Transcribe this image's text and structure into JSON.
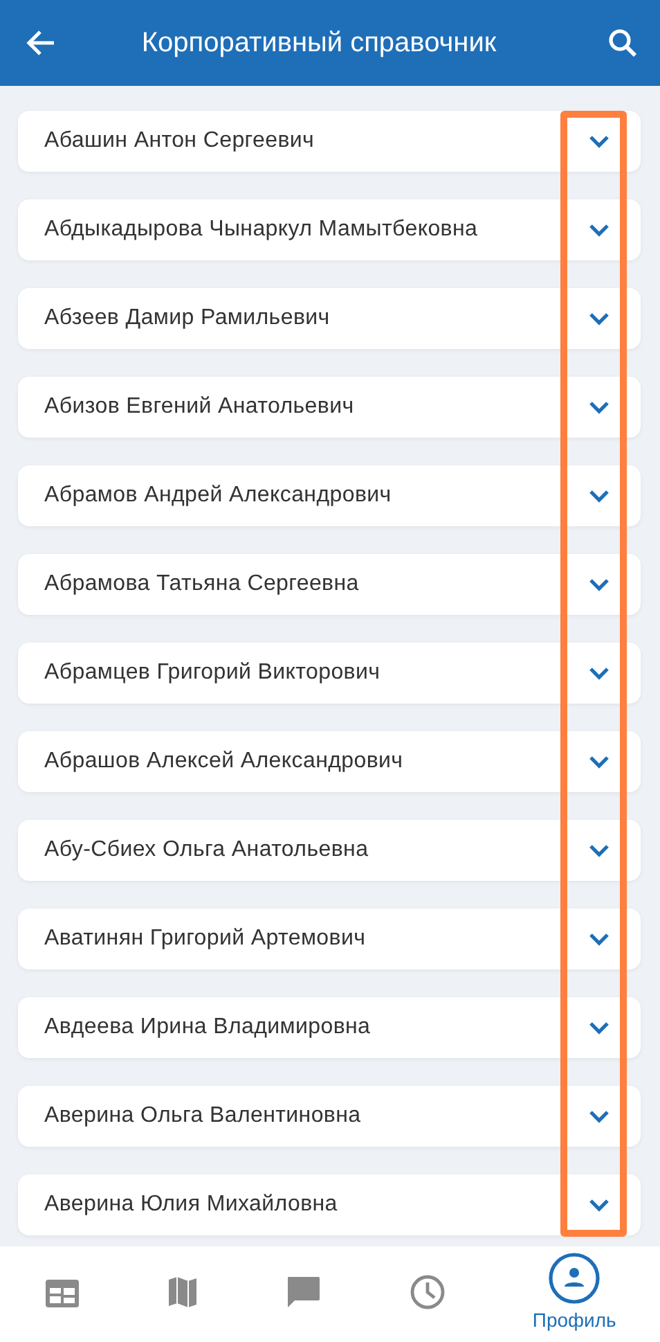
{
  "header": {
    "title": "Корпоративный справочник"
  },
  "contacts": [
    {
      "name": "Абашин Антон Сергеевич",
      "expanded": false
    },
    {
      "name": "Абдыкадырова Чынаркул Мамытбековна",
      "expanded": false
    },
    {
      "name": "Абзеев Дамир Рамильевич",
      "expanded": false
    },
    {
      "name": "Абизов Евгений Анатольевич",
      "expanded": false
    },
    {
      "name": "Абрамов Андрей Александрович",
      "expanded": false
    },
    {
      "name": "Абрамова Татьяна Сергеевна",
      "expanded": false
    },
    {
      "name": "Абрамцев Григорий Викторович",
      "expanded": false
    },
    {
      "name": "Абрашов Алексей Александрович",
      "expanded": false
    },
    {
      "name": "Абу-Сбиех Ольга Анатольевна",
      "expanded": false
    },
    {
      "name": "Аватинян Григорий Артемович",
      "expanded": false
    },
    {
      "name": "Авдеева Ирина Владимировна",
      "expanded": false
    },
    {
      "name": "Аверина Ольга Валентиновна",
      "expanded": false
    },
    {
      "name": "Аверина Юлия Михайловна",
      "expanded": false
    }
  ],
  "nav": [
    {
      "kind": "calendar",
      "selected": false
    },
    {
      "kind": "map",
      "selected": false
    },
    {
      "kind": "chat",
      "selected": false
    },
    {
      "kind": "history",
      "selected": false
    },
    {
      "kind": "profile",
      "selected": true,
      "label": "Профиль"
    }
  ]
}
